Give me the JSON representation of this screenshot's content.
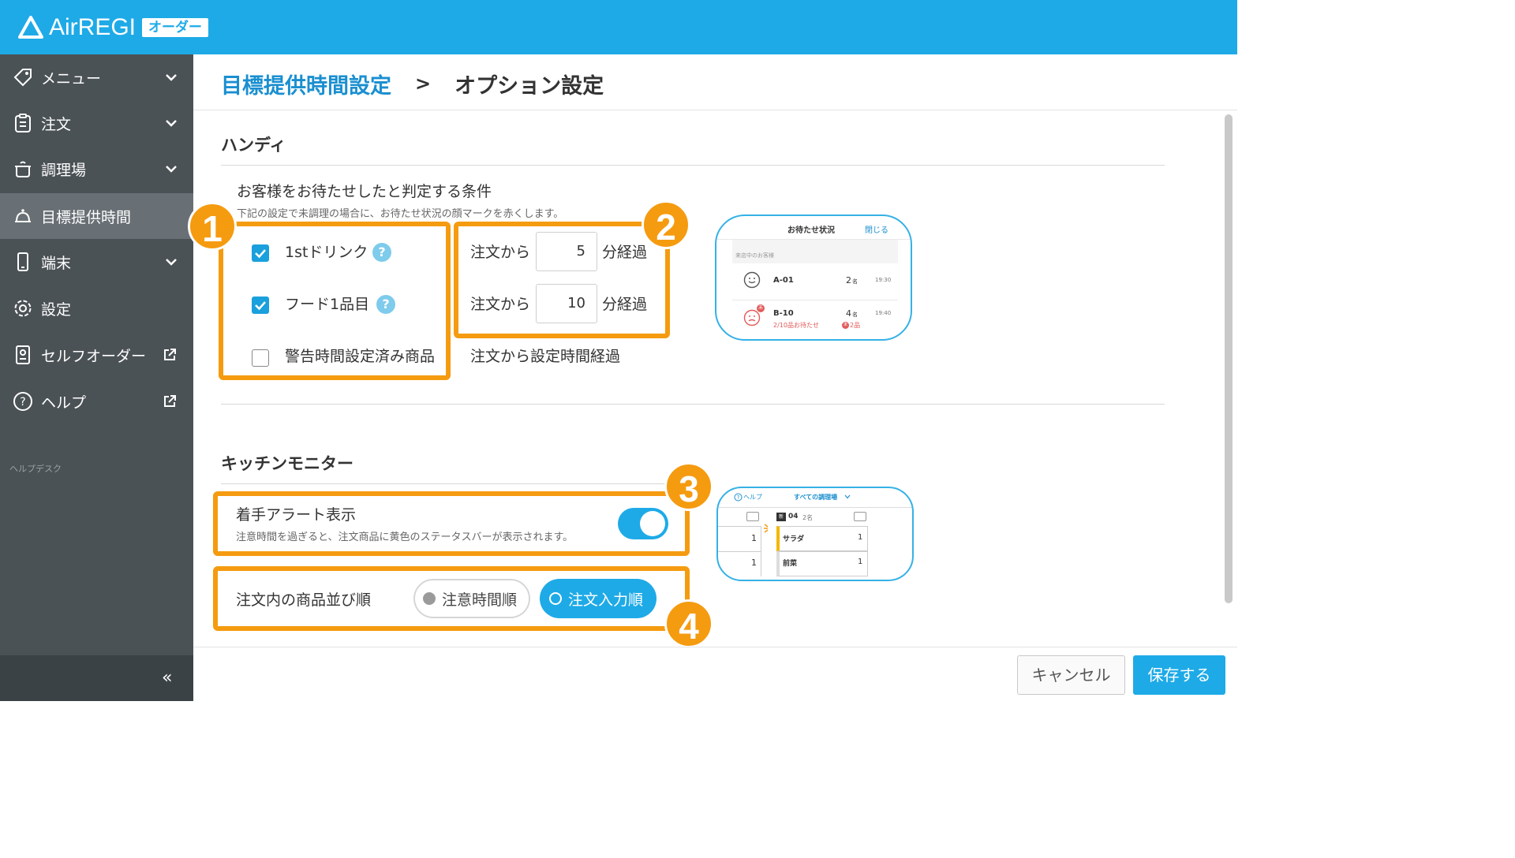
{
  "app": {
    "brand": "AirREGI",
    "badge": "オーダー"
  },
  "sidebar": {
    "items": [
      {
        "label": "メニュー",
        "icon": "tag-icon"
      },
      {
        "label": "注文",
        "icon": "clipboard-icon"
      },
      {
        "label": "調理場",
        "icon": "cooking-pot-icon"
      },
      {
        "label": "目標提供時間",
        "icon": "cloche-icon"
      },
      {
        "label": "端末",
        "icon": "smartphone-icon"
      },
      {
        "label": "設定",
        "icon": "gear-icon"
      },
      {
        "label": "セルフオーダー",
        "icon": "self-order-icon"
      },
      {
        "label": "ヘルプ",
        "icon": "help-circle-icon"
      }
    ],
    "active": "目標提供時間",
    "helpdesk": "ヘルプデスク",
    "collapse": "«"
  },
  "breadcrumb": {
    "parent": "目標提供時間設定",
    "separator": ">",
    "current": "オプション設定"
  },
  "handy": {
    "title": "ハンディ",
    "condition_title": "お客様をお待たせしたと判定する条件",
    "condition_desc": "下記の設定で未調理の場合に、お待たせ状況の顔マークを赤くします。",
    "rows": [
      {
        "label": "1stドリンク",
        "checked": true,
        "prefix": "注文から",
        "minutes": "5",
        "suffix": "分経過"
      },
      {
        "label": "フード1品目",
        "checked": true,
        "prefix": "注文から",
        "minutes": "10",
        "suffix": "分経過"
      },
      {
        "label": "警告時間設定済み商品",
        "checked": false,
        "text": "注文から設定時間経過"
      }
    ],
    "preview": {
      "title": "お待たせ状況",
      "close": "閉じる",
      "subtitle": "来店中のお客様",
      "rows": [
        {
          "table": "A-01",
          "people": "2",
          "unit": "名",
          "time": "19:30"
        },
        {
          "table": "B-10",
          "people": "4",
          "unit": "名",
          "time": "19:40",
          "waiting": "2/10品お待たせ",
          "items": "2品",
          "badge": "未"
        }
      ]
    }
  },
  "kitchen": {
    "title": "キッチンモニター",
    "alert_label": "着手アラート表示",
    "alert_desc": "注意時間を過ぎると、注文商品に黄色のステータスバーが表示されます。",
    "alert_on": true,
    "sort_label": "注文内の商品並び順",
    "sort_options": [
      "注意時間順",
      "注文入力順"
    ],
    "sort_selected": "注文入力順",
    "preview": {
      "help": "ヘルプ",
      "station": "すべての調理場",
      "order_no": "04",
      "people": "2名",
      "badge": "新",
      "rows": [
        {
          "qty_left": "1",
          "name": "サラダ",
          "qty": "1"
        },
        {
          "qty_left": "1",
          "name": "前菜",
          "qty": "1"
        }
      ]
    }
  },
  "callouts": [
    "1",
    "2",
    "3",
    "4"
  ],
  "footer": {
    "cancel": "キャンセル",
    "save": "保存する"
  },
  "colors": {
    "header": "#1eaae7",
    "sidebar": "#4b5256",
    "accent": "#1eaae7",
    "callout": "#f59b10"
  }
}
